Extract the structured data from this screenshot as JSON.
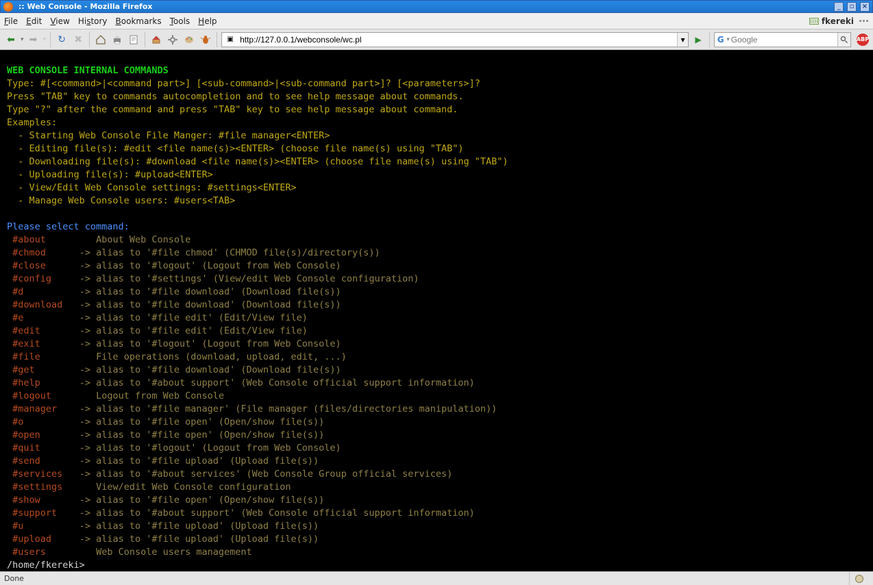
{
  "window": {
    "title": ":: Web Console - Mozilla Firefox"
  },
  "menubar": {
    "items": [
      {
        "accel": "F",
        "rest": "ile"
      },
      {
        "accel": "E",
        "rest": "dit"
      },
      {
        "accel": "V",
        "rest": "iew"
      },
      {
        "accel": "",
        "rest": "Hi",
        "accel2": "s",
        "rest2": "tory"
      },
      {
        "accel": "B",
        "rest": "ookmarks"
      },
      {
        "accel": "T",
        "rest": "ools"
      },
      {
        "accel": "H",
        "rest": "elp"
      }
    ],
    "brand": "fkereki"
  },
  "toolbar": {
    "back": "←",
    "forward": "→",
    "reload": "⟳",
    "stop": "✕",
    "url": "http://127.0.0.1/webconsole/wc.pl",
    "search_engine": "G",
    "search_placeholder": "Google"
  },
  "statusbar": {
    "text": "Done"
  },
  "console": {
    "header": "WEB CONSOLE INTERNAL COMMANDS",
    "intro": [
      "Type: #[<command>|<command part>] [<sub-command>|<sub-command part>]? [<parameters>]?",
      "Press \"TAB\" key to commands autocompletion and to see help message about commands.",
      "Type \"?\" after the command and press \"TAB\" key to see help message about command.",
      "Examples:",
      "  - Starting Web Console File Manger: #file manager<ENTER>",
      "  - Editing file(s): #edit <file name(s)><ENTER> (choose file name(s) using \"TAB\")",
      "  - Downloading file(s): #download <file name(s)><ENTER> (choose file name(s) using \"TAB\")",
      "  - Uploading file(s): #upload<ENTER>",
      "  - View/Edit Web Console settings: #settings<ENTER>",
      "  - Manage Web Console users: #users<TAB>"
    ],
    "select_cmd": "Please select command:",
    "commands": [
      {
        "name": "#about",
        "sep": "   ",
        "desc": "About Web Console"
      },
      {
        "name": "#chmod",
        "sep": "-> ",
        "desc": "alias to '#file chmod' (CHMOD file(s)/directory(s))"
      },
      {
        "name": "#close",
        "sep": "-> ",
        "desc": "alias to '#logout' (Logout from Web Console)"
      },
      {
        "name": "#config",
        "sep": "-> ",
        "desc": "alias to '#settings' (View/edit Web Console configuration)"
      },
      {
        "name": "#d",
        "sep": "-> ",
        "desc": "alias to '#file download' (Download file(s))"
      },
      {
        "name": "#download",
        "sep": "-> ",
        "desc": "alias to '#file download' (Download file(s))"
      },
      {
        "name": "#e",
        "sep": "-> ",
        "desc": "alias to '#file edit' (Edit/View file)"
      },
      {
        "name": "#edit",
        "sep": "-> ",
        "desc": "alias to '#file edit' (Edit/View file)"
      },
      {
        "name": "#exit",
        "sep": "-> ",
        "desc": "alias to '#logout' (Logout from Web Console)"
      },
      {
        "name": "#file",
        "sep": "   ",
        "desc": "File operations (download, upload, edit, ...)"
      },
      {
        "name": "#get",
        "sep": "-> ",
        "desc": "alias to '#file download' (Download file(s))"
      },
      {
        "name": "#help",
        "sep": "-> ",
        "desc": "alias to '#about support' (Web Console official support information)"
      },
      {
        "name": "#logout",
        "sep": "   ",
        "desc": "Logout from Web Console"
      },
      {
        "name": "#manager",
        "sep": "-> ",
        "desc": "alias to '#file manager' (File manager (files/directories manipulation))"
      },
      {
        "name": "#o",
        "sep": "-> ",
        "desc": "alias to '#file open' (Open/show file(s))"
      },
      {
        "name": "#open",
        "sep": "-> ",
        "desc": "alias to '#file open' (Open/show file(s))"
      },
      {
        "name": "#quit",
        "sep": "-> ",
        "desc": "alias to '#logout' (Logout from Web Console)"
      },
      {
        "name": "#send",
        "sep": "-> ",
        "desc": "alias to '#file upload' (Upload file(s))"
      },
      {
        "name": "#services",
        "sep": "-> ",
        "desc": "alias to '#about services' (Web Console Group official services)"
      },
      {
        "name": "#settings",
        "sep": "   ",
        "desc": "View/edit Web Console configuration"
      },
      {
        "name": "#show",
        "sep": "-> ",
        "desc": "alias to '#file open' (Open/show file(s))"
      },
      {
        "name": "#support",
        "sep": "-> ",
        "desc": "alias to '#about support' (Web Console official support information)"
      },
      {
        "name": "#u",
        "sep": "-> ",
        "desc": "alias to '#file upload' (Upload file(s))"
      },
      {
        "name": "#upload",
        "sep": "-> ",
        "desc": "alias to '#file upload' (Upload file(s))"
      },
      {
        "name": "#users",
        "sep": "   ",
        "desc": "Web Console users management"
      }
    ],
    "prompt": "/home/fkereki>"
  }
}
